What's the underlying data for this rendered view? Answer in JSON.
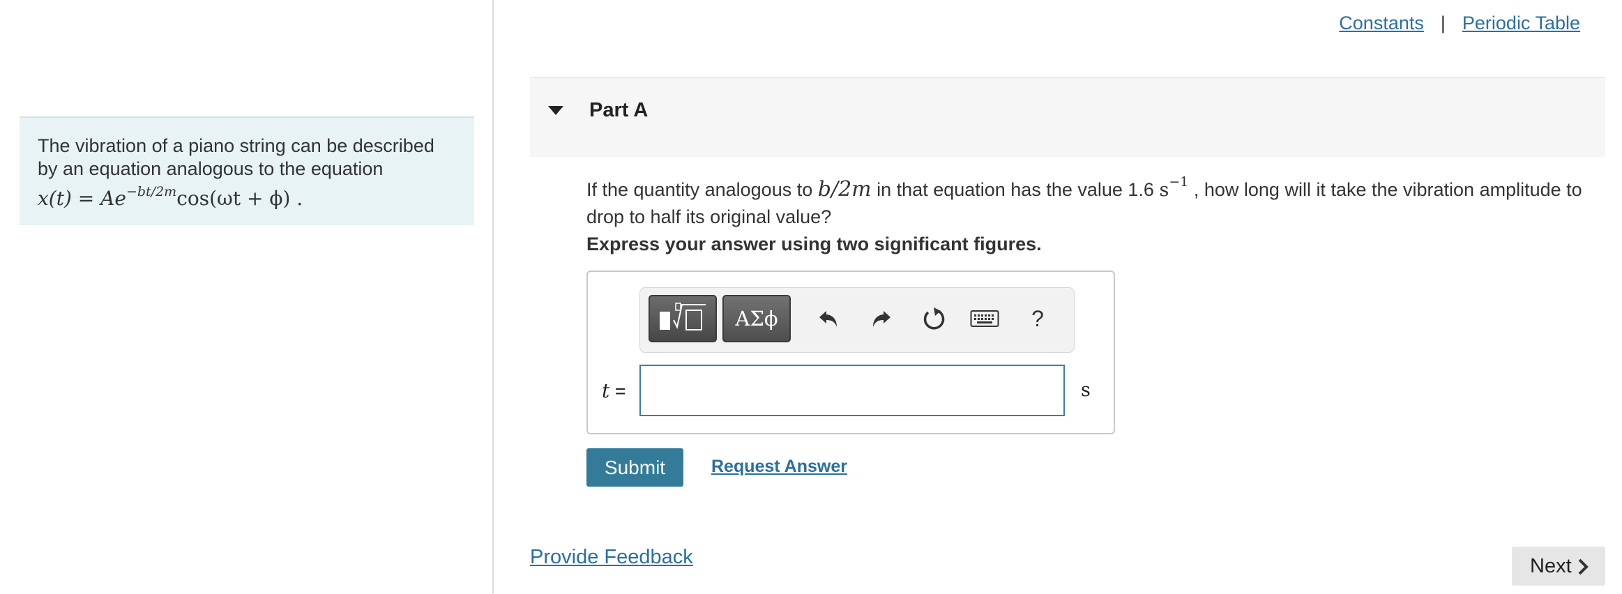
{
  "header": {
    "constants_link": "Constants",
    "separator": "|",
    "periodic_table_link": "Periodic Table"
  },
  "intro": {
    "text": "The vibration of a piano string can be described by an equation analogous to the equation",
    "equation_lhs": "x(t) = Ae",
    "equation_exponent": "−bt/2m",
    "equation_rhs": "cos(ωt + ϕ)",
    "equation_end": "."
  },
  "part": {
    "title": "Part A",
    "question_before": "If the quantity analogous to",
    "question_math": "b/2m",
    "question_middle": "in that equation has the value 1.6",
    "question_unit": "s",
    "question_unit_exponent": "−1",
    "question_after": ", how long will it take the vibration amplitude to drop to half its original value?",
    "instruction": "Express your answer using two significant figures."
  },
  "toolbar": {
    "greek_label": "ΑΣϕ",
    "help_label": "?",
    "icons": [
      "templates-icon",
      "greek-letters-icon",
      "undo-icon",
      "redo-icon",
      "reset-icon",
      "keyboard-icon",
      "help-icon"
    ]
  },
  "answer": {
    "variable": "t",
    "equals": "=",
    "value": "",
    "unit": "s"
  },
  "actions": {
    "submit_label": "Submit",
    "request_label": "Request Answer",
    "feedback_label": "Provide Feedback",
    "next_label": "Next"
  },
  "colors": {
    "accent": "#337b99",
    "link": "#2a6fa0",
    "intro_bg": "#e7f3f5"
  }
}
